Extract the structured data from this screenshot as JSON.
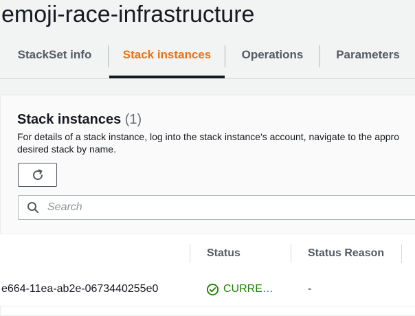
{
  "page": {
    "title": "emoji-race-infrastructure"
  },
  "tabs": [
    {
      "label": "StackSet info",
      "active": false
    },
    {
      "label": "Stack instances",
      "active": true
    },
    {
      "label": "Operations",
      "active": false
    },
    {
      "label": "Parameters",
      "active": false
    }
  ],
  "panel": {
    "title": "Stack instances",
    "count": "(1)",
    "description_line1": "For details of a stack instance, log into the stack instance's account, navigate to the appro",
    "description_line2": "desired stack by name."
  },
  "search": {
    "placeholder": "Search"
  },
  "table": {
    "columns": [
      "Status",
      "Status Reason"
    ],
    "rows": [
      {
        "stack_id": "e664-11ea-ab2e-0673440255e0",
        "status": "CURRE…",
        "status_reason": "-"
      }
    ]
  },
  "colors": {
    "accent": "#ec7211",
    "status_ok": "#1d8102"
  },
  "icons": {
    "refresh": "refresh-icon",
    "search": "search-icon",
    "status": "check-circle-icon"
  }
}
